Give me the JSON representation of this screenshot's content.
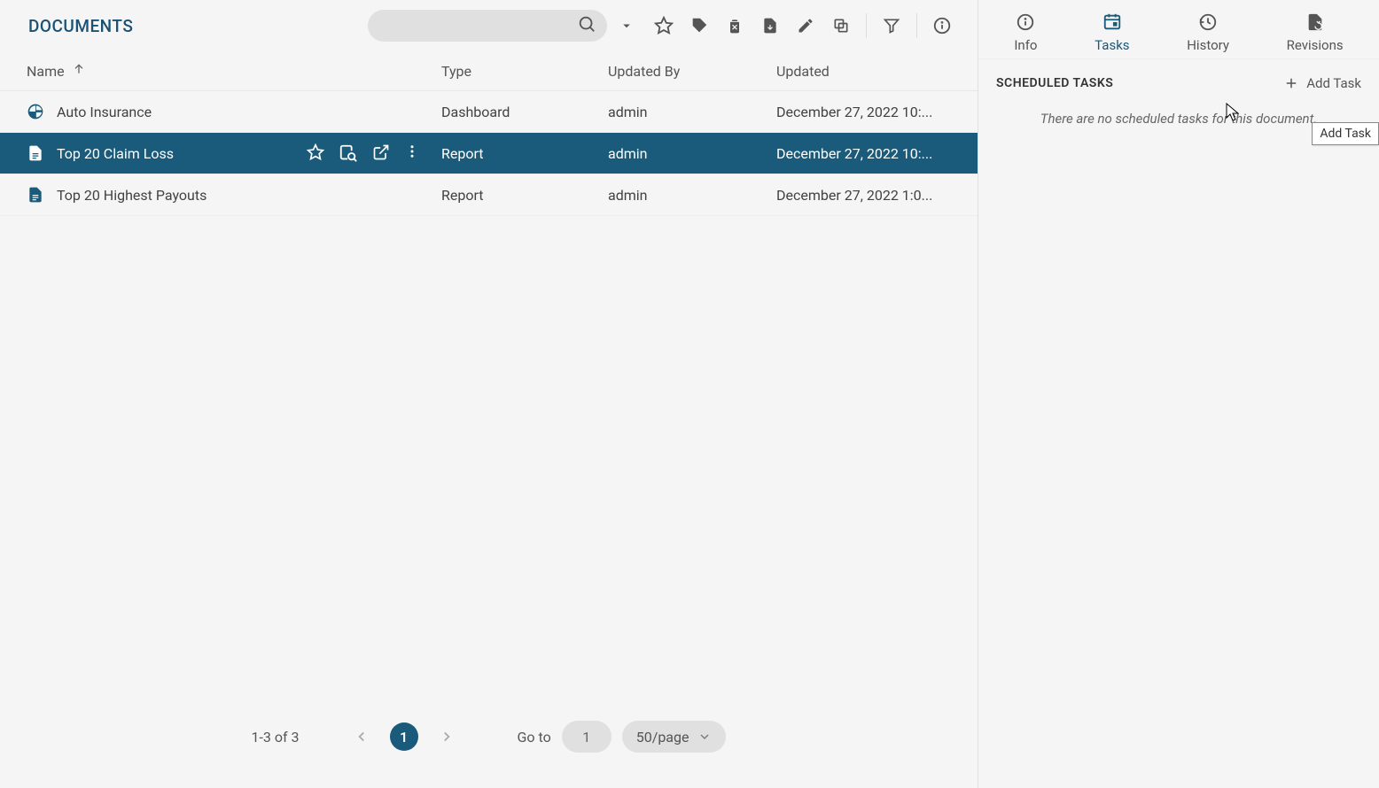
{
  "header": {
    "title": "DOCUMENTS"
  },
  "toolbar": {
    "search_placeholder": ""
  },
  "table": {
    "columns": {
      "name": "Name",
      "type": "Type",
      "updatedBy": "Updated By",
      "updated": "Updated"
    },
    "rows": [
      {
        "name": "Auto Insurance",
        "type": "Dashboard",
        "updatedBy": "admin",
        "updated": "December 27, 2022 10:...",
        "icon": "dashboard",
        "selected": false
      },
      {
        "name": "Top 20 Claim Loss",
        "type": "Report",
        "updatedBy": "admin",
        "updated": "December 27, 2022 10:...",
        "icon": "report",
        "selected": true
      },
      {
        "name": "Top 20 Highest Payouts",
        "type": "Report",
        "updatedBy": "admin",
        "updated": "December 27, 2022 1:0...",
        "icon": "report",
        "selected": false
      }
    ]
  },
  "pagination": {
    "range": "1-3 of 3",
    "current": "1",
    "gotoLabel": "Go to",
    "gotoValue": "1",
    "perPage": "50/page"
  },
  "sidebar": {
    "tabs": {
      "info": "Info",
      "tasks": "Tasks",
      "history": "History",
      "revisions": "Revisions"
    },
    "tasks": {
      "title": "SCHEDULED TASKS",
      "addTask": "Add Task",
      "empty": "There are no scheduled tasks for this document.",
      "tooltip": "Add Task"
    }
  }
}
